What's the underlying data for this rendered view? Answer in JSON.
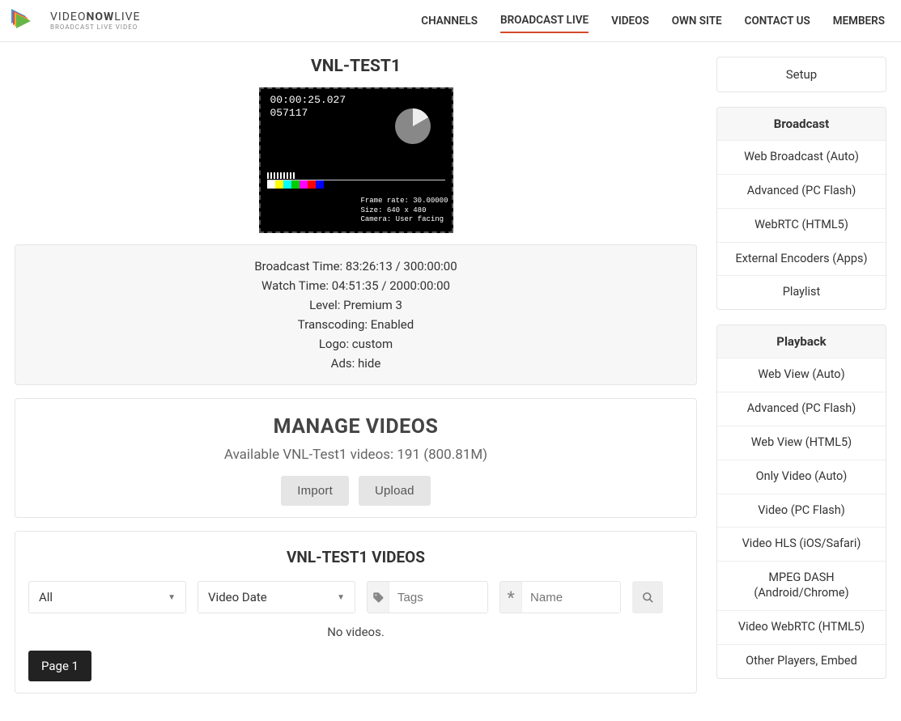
{
  "brand": {
    "name_a": "VIDEO",
    "name_b": "NOW",
    "name_c": "LIVE",
    "tagline": "BROADCAST LIVE VIDEO"
  },
  "nav": {
    "channels": "CHANNELS",
    "broadcast": "BROADCAST LIVE",
    "videos": "VIDEOS",
    "ownsite": "OWN SITE",
    "contact": "CONTACT US",
    "members": "MEMBERS"
  },
  "title": "VNL-TEST1",
  "preview": {
    "timecode": "00:00:25.027",
    "counter": "057117",
    "meta1": "Frame rate: 30.00000",
    "meta2": "Size: 640 x 480",
    "meta3": "Camera: User facing"
  },
  "stats": {
    "broadcast": "Broadcast Time: 83:26:13 / 300:00:00",
    "watch": "Watch Time: 04:51:35 / 2000:00:00",
    "level": "Level: Premium 3",
    "transcoding": "Transcoding: Enabled",
    "logo": "Logo: custom",
    "ads": "Ads: hide"
  },
  "manage": {
    "heading": "MANAGE VIDEOS",
    "available": "Available VNL-Test1 videos: 191 (800.81M)",
    "import_btn": "Import",
    "upload_btn": "Upload"
  },
  "videos": {
    "heading": "VNL-TEST1 VIDEOS",
    "filter_all": "All",
    "filter_date": "Video Date",
    "tags_placeholder": "Tags",
    "name_placeholder": "Name",
    "empty": "No videos.",
    "pager": "Page 1",
    "asterisk": "*"
  },
  "sidebar": {
    "setup": "Setup",
    "broadcast_hdr": "Broadcast",
    "broadcast": {
      "auto": "Web Broadcast (Auto)",
      "flash": "Advanced (PC Flash)",
      "webrtc": "WebRTC (HTML5)",
      "ext": "External Encoders (Apps)",
      "playlist": "Playlist"
    },
    "playback_hdr": "Playback",
    "playback": {
      "auto": "Web View (Auto)",
      "advflash": "Advanced (PC Flash)",
      "html5": "Web View (HTML5)",
      "onlyauto": "Only Video (Auto)",
      "vflash": "Video (PC Flash)",
      "hls": "Video HLS (iOS/Safari)",
      "dash": "MPEG DASH (Android/Chrome)",
      "vwebrtc": "Video WebRTC (HTML5)",
      "other": "Other Players, Embed"
    }
  }
}
